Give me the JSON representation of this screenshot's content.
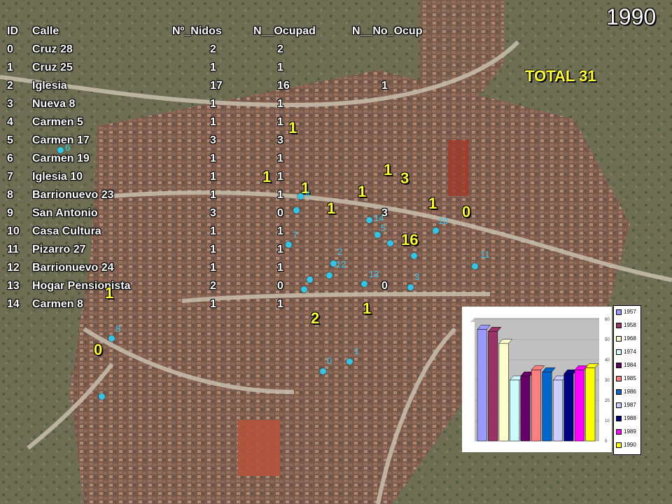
{
  "map": {
    "year": "1990",
    "total_label": "TOTAL 31",
    "table": {
      "headers": [
        "ID",
        "Calle",
        "Nº_Nidos",
        "N__Ocupad",
        "N__No_Ocup"
      ],
      "rows": [
        [
          "0",
          "Cruz 28",
          "2",
          "2",
          ""
        ],
        [
          "1",
          "Cruz 25",
          "1",
          "1",
          ""
        ],
        [
          "2",
          "Iglesia",
          "17",
          "16",
          "1"
        ],
        [
          "3",
          "Nueva 8",
          "1",
          "1",
          ""
        ],
        [
          "4",
          "Carmen 5",
          "1",
          "1",
          ""
        ],
        [
          "5",
          "Carmen 17",
          "3",
          "3",
          ""
        ],
        [
          "6",
          "Carmen 19",
          "1",
          "1",
          ""
        ],
        [
          "7",
          "Iglesia 10",
          "1",
          "1",
          ""
        ],
        [
          "8",
          "Barrionuevo 23",
          "1",
          "1",
          ""
        ],
        [
          "9",
          "San Antonio",
          "3",
          "0",
          "3"
        ],
        [
          "10",
          "Casa Cultura",
          "1",
          "1",
          ""
        ],
        [
          "11",
          "Pizarro 27",
          "1",
          "1",
          ""
        ],
        [
          "12",
          "Barrionuevo 24",
          "1",
          "1",
          ""
        ],
        [
          "13",
          "Hogar Pensionista",
          "2",
          "0",
          "0"
        ],
        [
          "14",
          "Carmen 8",
          "1",
          "1",
          ""
        ]
      ]
    },
    "counts": [
      "1",
      "1",
      "3",
      "1",
      "1",
      "1",
      "1",
      "1",
      "0",
      "16",
      "1",
      "1",
      "2",
      "0"
    ],
    "id_labels": [
      "6",
      "4",
      "14",
      "5",
      "7",
      "10",
      "2",
      "11",
      "12",
      "9",
      "13",
      "3",
      "8",
      "0",
      "1"
    ],
    "colors": {
      "marker": "#33c4e6",
      "count_text": "#ffff33"
    }
  },
  "chart_data": {
    "type": "bar",
    "title": "",
    "xlabel": "",
    "ylabel": "",
    "categories": [
      "1957",
      "1958",
      "1968",
      "1974",
      "1984",
      "1985",
      "1986",
      "1987",
      "1988",
      "1989",
      "1990"
    ],
    "values": [
      55,
      54,
      48,
      30,
      32,
      35,
      34,
      30,
      33,
      35,
      36
    ],
    "ylim": [
      0,
      60
    ],
    "yticks": [
      "0",
      "10",
      "20",
      "30",
      "40",
      "50",
      "60"
    ],
    "grid": true,
    "legend_position": "right",
    "legend": [
      "1957",
      "1958",
      "1968",
      "1974",
      "1984",
      "1985",
      "1986",
      "1987",
      "1988",
      "1989",
      "1990"
    ],
    "colors": [
      "#9999ff",
      "#993366",
      "#ffffcc",
      "#ccffff",
      "#660066",
      "#ff8080",
      "#0066cc",
      "#ccccff",
      "#000080",
      "#ff00ff",
      "#ffff00"
    ]
  }
}
